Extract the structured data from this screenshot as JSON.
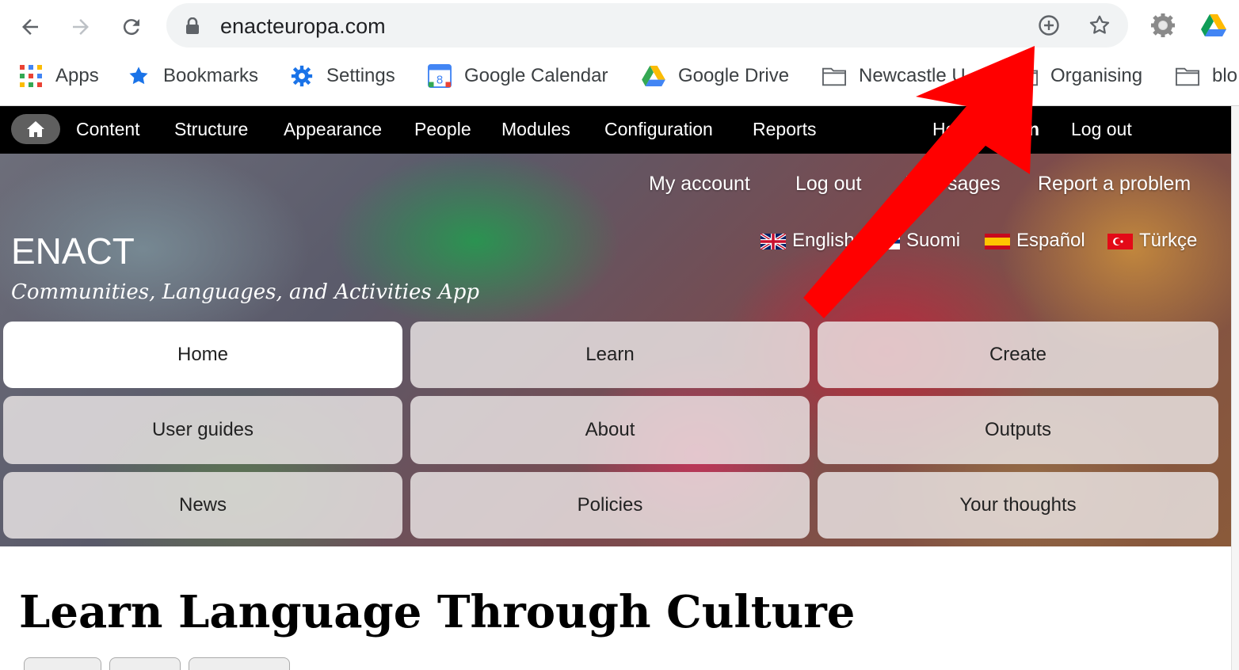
{
  "browser": {
    "url": "enacteuropa.com",
    "bookmarks": [
      {
        "label": "Apps",
        "icon": "apps-grid-icon"
      },
      {
        "label": "Bookmarks",
        "icon": "star-icon"
      },
      {
        "label": "Settings",
        "icon": "gear-icon"
      },
      {
        "label": "Google Calendar",
        "icon": "google-calendar-icon",
        "badge": "8"
      },
      {
        "label": "Google Drive",
        "icon": "google-drive-icon"
      },
      {
        "label": "Newcastle U",
        "icon": "folder-icon"
      },
      {
        "label": "Organising",
        "icon": "folder-icon"
      },
      {
        "label": "blo",
        "icon": "folder-icon"
      }
    ]
  },
  "admin_toolbar": {
    "items": [
      "Content",
      "Structure",
      "Appearance",
      "People",
      "Modules",
      "Configuration",
      "Reports"
    ],
    "help_label": "He",
    "admin_label": "n",
    "logout_label": "Log out"
  },
  "header": {
    "user_links": [
      "My account",
      "Log out",
      "M",
      "sages",
      "Report a problem"
    ],
    "languages": [
      {
        "label": "English",
        "flag": "uk-flag-icon"
      },
      {
        "label": "Suomi",
        "flag": "finland-flag-icon"
      },
      {
        "label": "Español",
        "flag": "spain-flag-icon"
      },
      {
        "label": "Türkçe",
        "flag": "turkey-flag-icon"
      }
    ],
    "site_name": "ENACT",
    "slogan": "Communities, Languages, and Activities App"
  },
  "main_menu": [
    "Home",
    "Learn",
    "Create",
    "User guides",
    "About",
    "Outputs",
    "News",
    "Policies",
    "Your thoughts"
  ],
  "active_menu_item": "Home",
  "page": {
    "title": "Learn Language Through Culture"
  },
  "colors": {
    "annotation_arrow": "#ff0000",
    "admin_bar": "#000000"
  }
}
